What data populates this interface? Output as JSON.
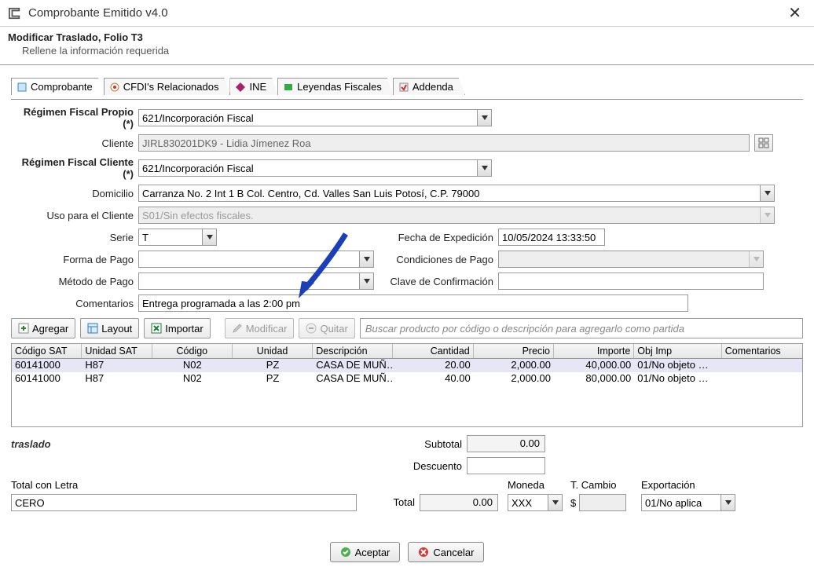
{
  "window": {
    "title": "Comprobante Emitido v4.0"
  },
  "header": {
    "title": "Modificar Traslado, Folio T3",
    "subtitle": "Rellene la información requerida"
  },
  "tabs": [
    "Comprobante",
    "CFDI's Relacionados",
    "INE",
    "Leyendas Fiscales",
    "Addenda"
  ],
  "form": {
    "regimen_propio_lbl": "Régimen Fiscal Propio (*)",
    "regimen_propio": "621/Incorporación Fiscal",
    "cliente_lbl": "Cliente",
    "cliente": "JIRL830201DK9 - Lidia Jímenez Roa",
    "regimen_cliente_lbl": "Régimen Fiscal Cliente (*)",
    "regimen_cliente": "621/Incorporación Fiscal",
    "domicilio_lbl": "Domicilio",
    "domicilio": "Carranza No. 2 Int 1 B Col. Centro, Cd. Valles San Luis Potosí, C.P. 79000",
    "uso_lbl": "Uso para el Cliente",
    "uso": "S01/Sin efectos fiscales.",
    "serie_lbl": "Serie",
    "serie": "T",
    "fecha_lbl": "Fecha de Expedición",
    "fecha": "10/05/2024 13:33:50",
    "forma_lbl": "Forma de Pago",
    "forma": "",
    "cond_lbl": "Condiciones de Pago",
    "cond": "",
    "metodo_lbl": "Método de Pago",
    "metodo": "",
    "clave_lbl": "Clave de Confirmación",
    "clave": "",
    "coment_lbl": "Comentarios",
    "coment": "Entrega programada a las 2:00 pm"
  },
  "toolbar": {
    "agregar": "Agregar",
    "layout": "Layout",
    "importar": "Importar",
    "modificar": "Modificar",
    "quitar": "Quitar",
    "search_ph": "Buscar producto por código o descripción para agregarlo como partida"
  },
  "table": {
    "headers": [
      "Código SAT",
      "Unidad SAT",
      "Código",
      "Unidad",
      "Descripción",
      "Cantidad",
      "Precio",
      "Importe",
      "Obj Imp",
      "Comentarios"
    ],
    "rows": [
      [
        "60141000",
        "H87",
        "N02",
        "PZ",
        "CASA DE MUÑ…",
        "20.00",
        "2,000.00",
        "40,000.00",
        "01/No objeto …",
        ""
      ],
      [
        "60141000",
        "H87",
        "N02",
        "PZ",
        "CASA DE MUÑ…",
        "40.00",
        "2,000.00",
        "80,000.00",
        "01/No objeto …",
        ""
      ]
    ]
  },
  "totals": {
    "traslado": "traslado",
    "subtotal_lbl": "Subtotal",
    "subtotal": "0.00",
    "descuento_lbl": "Descuento",
    "descuento": "",
    "total_letra_lbl": "Total con Letra",
    "total_letra": "CERO",
    "total_lbl": "Total",
    "total": "0.00",
    "moneda_lbl": "Moneda",
    "moneda": "XXX",
    "tcambio_lbl": "T. Cambio",
    "tcambio_prefix": "$",
    "tcambio": "",
    "export_lbl": "Exportación",
    "export": "01/No aplica"
  },
  "footer": {
    "aceptar": "Aceptar",
    "cancelar": "Cancelar"
  }
}
